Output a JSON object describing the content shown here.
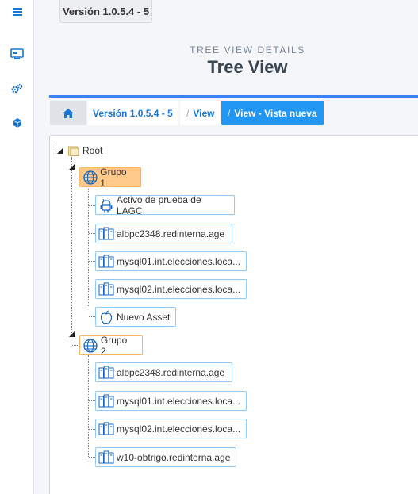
{
  "sidebar": {
    "items": [
      {
        "icon": "hamburger-menu-icon"
      },
      {
        "icon": "monitor-icon"
      },
      {
        "icon": "gears-icon"
      },
      {
        "icon": "cube-icon"
      }
    ]
  },
  "topbar": {
    "version": "Versión 1.0.5.4 - 5"
  },
  "header": {
    "subtitle": "TREE VIEW DETAILS",
    "title": "Tree View"
  },
  "breadcrumb": {
    "separator": "/",
    "items": [
      "Versión 1.0.5.4 - 5",
      "View",
      "View - Vista nueva"
    ]
  },
  "tree": {
    "root": "Root",
    "groups": [
      {
        "label": "Grupo 1",
        "assets": [
          {
            "label": "Activo de prueba de LAGC",
            "icon": "android-icon"
          },
          {
            "label": "albpc2348.redinterna.age",
            "icon": "server-icon"
          },
          {
            "label": "mysql01.int.elecciones.loca...",
            "icon": "server-icon"
          },
          {
            "label": "mysql02.int.elecciones.loca...",
            "icon": "server-icon"
          },
          {
            "label": "Nuevo Asset",
            "icon": "apple-icon"
          }
        ]
      },
      {
        "label": "Grupo 2",
        "assets": [
          {
            "label": "albpc2348.redinterna.age",
            "icon": "server-icon"
          },
          {
            "label": "mysql01.int.elecciones.loca...",
            "icon": "server-icon"
          },
          {
            "label": "mysql02.int.elecciones.loca...",
            "icon": "server-icon"
          },
          {
            "label": "w10-obtrigo.redinterna.age",
            "icon": "server-icon"
          }
        ]
      }
    ]
  },
  "colors": {
    "accent": "#2196f3",
    "group_selected": "#ffc98a",
    "group_border": "#ffb35c",
    "node_border": "#90caf9"
  }
}
